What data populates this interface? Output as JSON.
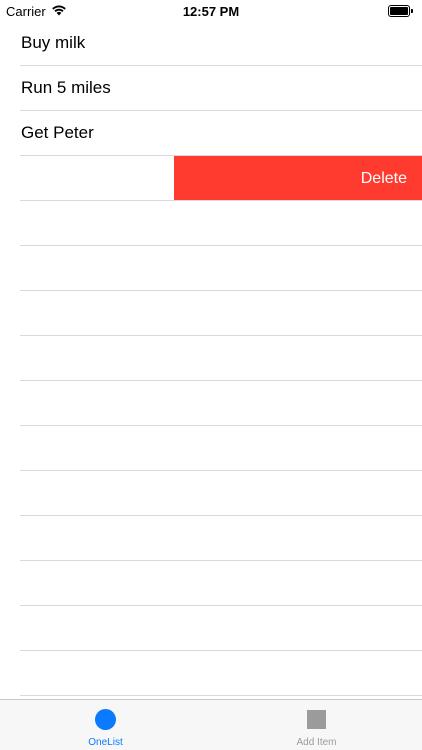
{
  "status_bar": {
    "carrier": "Carrier",
    "time": "12:57 PM",
    "wifi_icon": "wifi-icon",
    "battery_icon": "battery-icon"
  },
  "list": {
    "items": [
      {
        "label": "Buy milk"
      },
      {
        "label": "Run 5 miles"
      },
      {
        "label": "Get Peter"
      },
      {
        "label": ""
      }
    ],
    "swiped_row_action": "Delete",
    "delete_color": "#ff3b30"
  },
  "tab_bar": {
    "tabs": [
      {
        "label": "OneList",
        "icon": "circle-icon",
        "selected": true
      },
      {
        "label": "Add Item",
        "icon": "square-icon",
        "selected": false
      }
    ],
    "accent_color": "#0a7aff",
    "inactive_color": "#9b9b9b"
  }
}
